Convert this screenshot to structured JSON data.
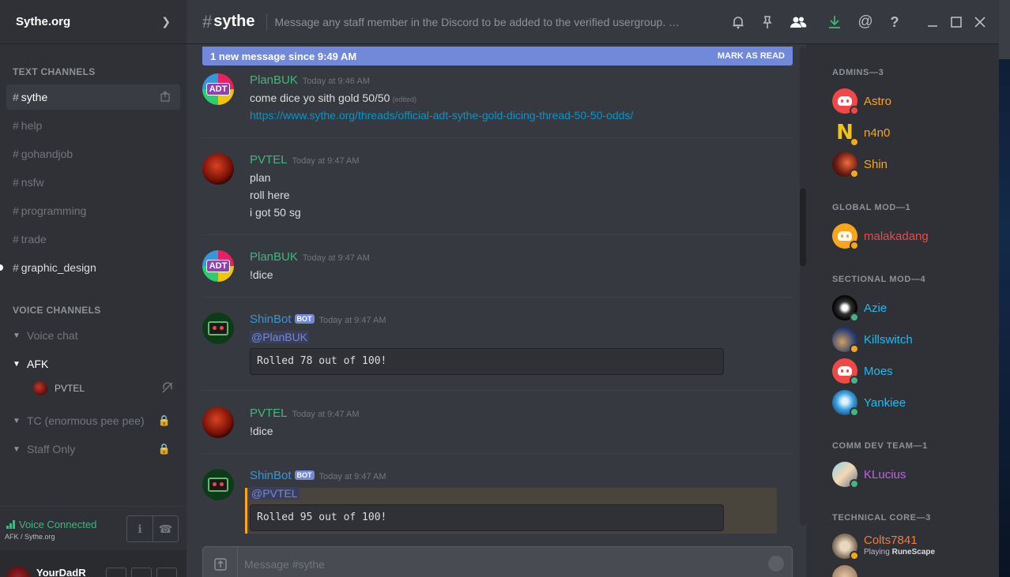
{
  "server": {
    "name": "Sythe.org"
  },
  "categories": {
    "text": "TEXT CHANNELS",
    "voice": "VOICE CHANNELS"
  },
  "text_channels": [
    {
      "name": "sythe",
      "state": "active"
    },
    {
      "name": "help",
      "state": "muted"
    },
    {
      "name": "gohandjob",
      "state": "muted"
    },
    {
      "name": "nsfw",
      "state": "muted"
    },
    {
      "name": "programming",
      "state": "muted"
    },
    {
      "name": "trade",
      "state": "muted"
    },
    {
      "name": "graphic_design",
      "state": "unread"
    }
  ],
  "voice_channels": [
    {
      "name": "Voice chat",
      "open": false,
      "locked": false
    },
    {
      "name": "AFK",
      "open": true,
      "locked": false,
      "users": [
        "PVTEL"
      ]
    },
    {
      "name": "TC (enormous pee pee)",
      "open": false,
      "locked": true
    },
    {
      "name": "Staff Only",
      "open": false,
      "locked": true
    }
  ],
  "voice_status": {
    "title": "Voice Connected",
    "subtitle": "AFK / Sythe.org"
  },
  "current_user": {
    "name": "YourDadR"
  },
  "header": {
    "channel": "sythe",
    "topic": "Message any staff member in the Discord to be added to the verified usergroup. You m..."
  },
  "new_message_bar": {
    "text": "1 new message since 9:49 AM",
    "action": "MARK AS READ"
  },
  "messages": [
    {
      "author": "PlanBUK",
      "color": "#43b581",
      "time": "Today at 9:46 AM",
      "avatar": "adt",
      "lines": [
        "come dice yo sith gold 50/50",
        "https://www.sythe.org/threads/official-adt-sythe-gold-dicing-thread-50-50-odds/"
      ],
      "edited": "(edited)"
    },
    {
      "author": "PVTEL",
      "color": "#43b581",
      "time": "Today at 9:47 AM",
      "avatar": "pvtel",
      "lines": [
        "plan",
        "roll here",
        "i got 50 sg"
      ]
    },
    {
      "author": "PlanBUK",
      "color": "#43b581",
      "time": "Today at 9:47 AM",
      "avatar": "adt",
      "lines": [
        "!dice"
      ]
    },
    {
      "author": "ShinBot",
      "color": "#3498db",
      "time": "Today at 9:47 AM",
      "avatar": "bot",
      "bot": "BOT",
      "mention": "@PlanBUK",
      "code": "Rolled 78 out of 100!"
    },
    {
      "author": "PVTEL",
      "color": "#43b581",
      "time": "Today at 9:47 AM",
      "avatar": "pvtel",
      "lines": [
        "!dice"
      ]
    },
    {
      "author": "ShinBot",
      "color": "#3498db",
      "time": "Today at 9:47 AM",
      "avatar": "bot",
      "bot": "BOT",
      "mention": "@PVTEL",
      "code": "Rolled 95 out of 100!"
    }
  ],
  "composer": {
    "placeholder": "Message #sythe"
  },
  "member_groups": [
    {
      "title": "ADMINS—3",
      "members": [
        {
          "name": "Astro",
          "color": "#faa61a",
          "status": "dnd",
          "avatar": "discord-red"
        },
        {
          "name": "n4n0",
          "color": "#faa61a",
          "status": "idle",
          "avatar": "n4n0"
        },
        {
          "name": "Shin",
          "color": "#faa61a",
          "status": "idle",
          "avatar": "shin"
        }
      ]
    },
    {
      "title": "GLOBAL MOD—1",
      "members": [
        {
          "name": "malakadang",
          "color": "#f04747",
          "status": "idle",
          "avatar": "discord-gold"
        }
      ]
    },
    {
      "title": "SECTIONAL MOD—4",
      "members": [
        {
          "name": "Azie",
          "color": "#1abcf6",
          "status": "online",
          "avatar": "azie"
        },
        {
          "name": "Killswitch",
          "color": "#1abcf6",
          "status": "idle",
          "avatar": "kill"
        },
        {
          "name": "Moes",
          "color": "#1abcf6",
          "status": "online",
          "avatar": "discord-red"
        },
        {
          "name": "Yankiee",
          "color": "#1abcf6",
          "status": "online",
          "avatar": "yank"
        }
      ]
    },
    {
      "title": "COMM DEV TEAM—1",
      "members": [
        {
          "name": "KLucius",
          "color": "#b968d9",
          "status": "online",
          "avatar": "kluc"
        }
      ]
    },
    {
      "title": "TECHNICAL CORE—3",
      "members": [
        {
          "name": "Colts7841",
          "color": "#f47b36",
          "status": "idle",
          "avatar": "colts",
          "playing": "Playing",
          "game": "RuneScape"
        }
      ]
    }
  ],
  "colors": {
    "accent": "#7289da",
    "online": "#43b581",
    "idle": "#faa61a",
    "dnd": "#f04747",
    "link": "#0096cf"
  }
}
